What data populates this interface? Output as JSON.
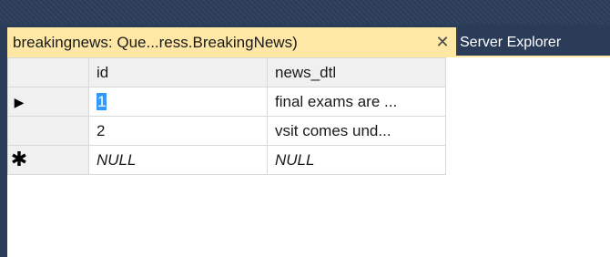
{
  "tabs": {
    "active_label": "breakingnews: Que...ress.BreakingNews)",
    "close_glyph": "✕",
    "inactive_label": "Server Explorer"
  },
  "grid": {
    "columns": [
      "id",
      "news_dtl"
    ],
    "rows": [
      {
        "marker": "▶",
        "id": "1",
        "news_dtl": "final exams are ..."
      },
      {
        "marker": "",
        "id": "2",
        "news_dtl": "vsit comes und..."
      },
      {
        "marker": "✱",
        "id": "NULL",
        "news_dtl": "NULL"
      }
    ]
  },
  "colors": {
    "frame": "#2b3c59",
    "active_tab": "#ffe8a6",
    "selection": "#3399ff",
    "header": "#f0f0f0"
  }
}
